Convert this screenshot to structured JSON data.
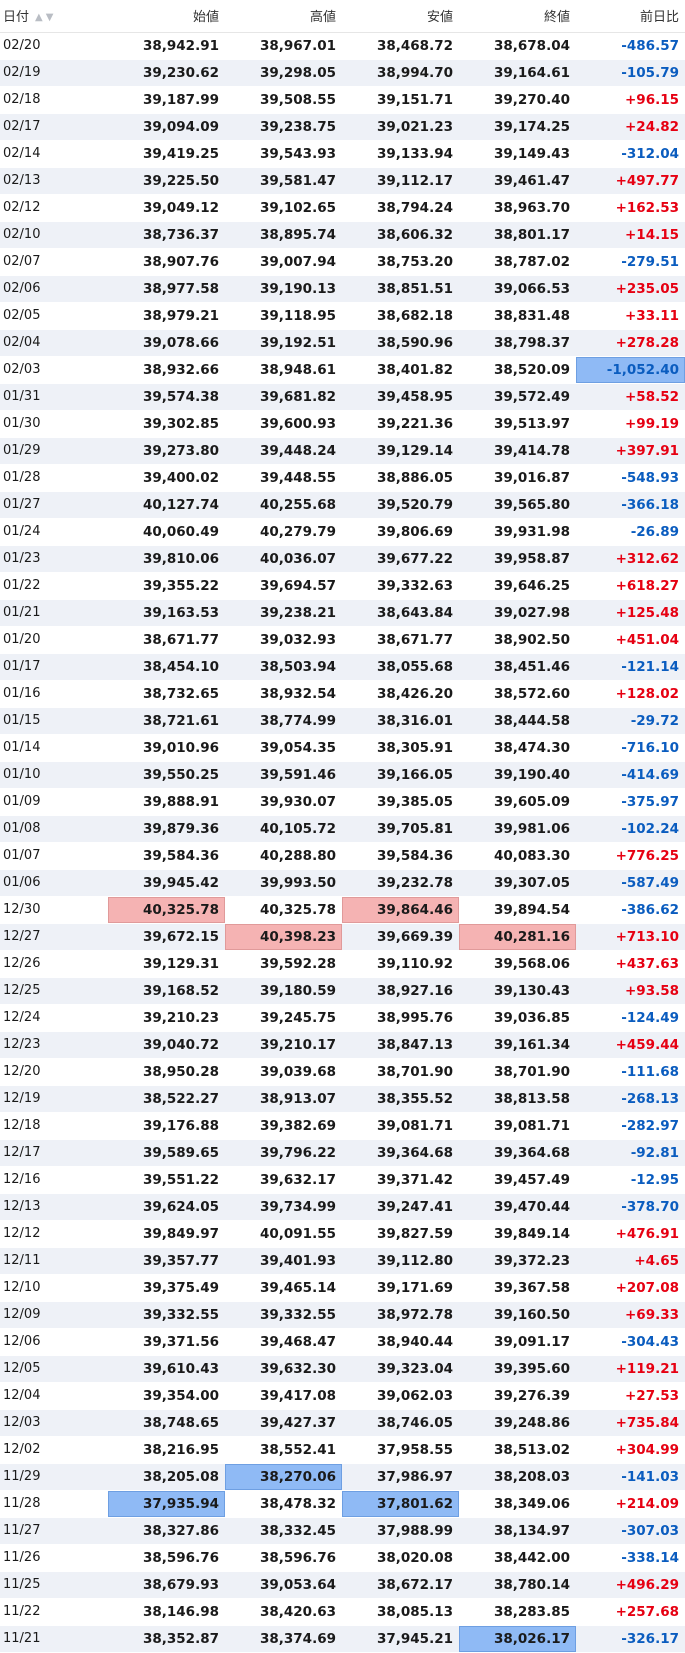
{
  "headers": {
    "date": "日付",
    "open": "始値",
    "high": "高値",
    "low": "安値",
    "close": "終値",
    "change": "前日比"
  },
  "rows": [
    {
      "date": "02/20",
      "open": "38,942.91",
      "high": "38,967.01",
      "low": "38,468.72",
      "close": "38,678.04",
      "change": "-486.57"
    },
    {
      "date": "02/19",
      "open": "39,230.62",
      "high": "39,298.05",
      "low": "38,994.70",
      "close": "39,164.61",
      "change": "-105.79"
    },
    {
      "date": "02/18",
      "open": "39,187.99",
      "high": "39,508.55",
      "low": "39,151.71",
      "close": "39,270.40",
      "change": "+96.15"
    },
    {
      "date": "02/17",
      "open": "39,094.09",
      "high": "39,238.75",
      "low": "39,021.23",
      "close": "39,174.25",
      "change": "+24.82"
    },
    {
      "date": "02/14",
      "open": "39,419.25",
      "high": "39,543.93",
      "low": "39,133.94",
      "close": "39,149.43",
      "change": "-312.04"
    },
    {
      "date": "02/13",
      "open": "39,225.50",
      "high": "39,581.47",
      "low": "39,112.17",
      "close": "39,461.47",
      "change": "+497.77"
    },
    {
      "date": "02/12",
      "open": "39,049.12",
      "high": "39,102.65",
      "low": "38,794.24",
      "close": "38,963.70",
      "change": "+162.53"
    },
    {
      "date": "02/10",
      "open": "38,736.37",
      "high": "38,895.74",
      "low": "38,606.32",
      "close": "38,801.17",
      "change": "+14.15"
    },
    {
      "date": "02/07",
      "open": "38,907.76",
      "high": "39,007.94",
      "low": "38,753.20",
      "close": "38,787.02",
      "change": "-279.51"
    },
    {
      "date": "02/06",
      "open": "38,977.58",
      "high": "39,190.13",
      "low": "38,851.51",
      "close": "39,066.53",
      "change": "+235.05"
    },
    {
      "date": "02/05",
      "open": "38,979.21",
      "high": "39,118.95",
      "low": "38,682.18",
      "close": "38,831.48",
      "change": "+33.11"
    },
    {
      "date": "02/04",
      "open": "39,078.66",
      "high": "39,192.51",
      "low": "38,590.96",
      "close": "38,798.37",
      "change": "+278.28"
    },
    {
      "date": "02/03",
      "open": "38,932.66",
      "high": "38,948.61",
      "low": "38,401.82",
      "close": "38,520.09",
      "change": "-1,052.40",
      "hl": {
        "change": "blue"
      }
    },
    {
      "date": "01/31",
      "open": "39,574.38",
      "high": "39,681.82",
      "low": "39,458.95",
      "close": "39,572.49",
      "change": "+58.52"
    },
    {
      "date": "01/30",
      "open": "39,302.85",
      "high": "39,600.93",
      "low": "39,221.36",
      "close": "39,513.97",
      "change": "+99.19"
    },
    {
      "date": "01/29",
      "open": "39,273.80",
      "high": "39,448.24",
      "low": "39,129.14",
      "close": "39,414.78",
      "change": "+397.91"
    },
    {
      "date": "01/28",
      "open": "39,400.02",
      "high": "39,448.55",
      "low": "38,886.05",
      "close": "39,016.87",
      "change": "-548.93"
    },
    {
      "date": "01/27",
      "open": "40,127.74",
      "high": "40,255.68",
      "low": "39,520.79",
      "close": "39,565.80",
      "change": "-366.18"
    },
    {
      "date": "01/24",
      "open": "40,060.49",
      "high": "40,279.79",
      "low": "39,806.69",
      "close": "39,931.98",
      "change": "-26.89"
    },
    {
      "date": "01/23",
      "open": "39,810.06",
      "high": "40,036.07",
      "low": "39,677.22",
      "close": "39,958.87",
      "change": "+312.62"
    },
    {
      "date": "01/22",
      "open": "39,355.22",
      "high": "39,694.57",
      "low": "39,332.63",
      "close": "39,646.25",
      "change": "+618.27"
    },
    {
      "date": "01/21",
      "open": "39,163.53",
      "high": "39,238.21",
      "low": "38,643.84",
      "close": "39,027.98",
      "change": "+125.48"
    },
    {
      "date": "01/20",
      "open": "38,671.77",
      "high": "39,032.93",
      "low": "38,671.77",
      "close": "38,902.50",
      "change": "+451.04"
    },
    {
      "date": "01/17",
      "open": "38,454.10",
      "high": "38,503.94",
      "low": "38,055.68",
      "close": "38,451.46",
      "change": "-121.14"
    },
    {
      "date": "01/16",
      "open": "38,732.65",
      "high": "38,932.54",
      "low": "38,426.20",
      "close": "38,572.60",
      "change": "+128.02"
    },
    {
      "date": "01/15",
      "open": "38,721.61",
      "high": "38,774.99",
      "low": "38,316.01",
      "close": "38,444.58",
      "change": "-29.72"
    },
    {
      "date": "01/14",
      "open": "39,010.96",
      "high": "39,054.35",
      "low": "38,305.91",
      "close": "38,474.30",
      "change": "-716.10"
    },
    {
      "date": "01/10",
      "open": "39,550.25",
      "high": "39,591.46",
      "low": "39,166.05",
      "close": "39,190.40",
      "change": "-414.69"
    },
    {
      "date": "01/09",
      "open": "39,888.91",
      "high": "39,930.07",
      "low": "39,385.05",
      "close": "39,605.09",
      "change": "-375.97"
    },
    {
      "date": "01/08",
      "open": "39,879.36",
      "high": "40,105.72",
      "low": "39,705.81",
      "close": "39,981.06",
      "change": "-102.24"
    },
    {
      "date": "01/07",
      "open": "39,584.36",
      "high": "40,288.80",
      "low": "39,584.36",
      "close": "40,083.30",
      "change": "+776.25"
    },
    {
      "date": "01/06",
      "open": "39,945.42",
      "high": "39,993.50",
      "low": "39,232.78",
      "close": "39,307.05",
      "change": "-587.49"
    },
    {
      "date": "12/30",
      "open": "40,325.78",
      "high": "40,325.78",
      "low": "39,864.46",
      "close": "39,894.54",
      "change": "-386.62",
      "hl": {
        "open": "red",
        "low": "red"
      }
    },
    {
      "date": "12/27",
      "open": "39,672.15",
      "high": "40,398.23",
      "low": "39,669.39",
      "close": "40,281.16",
      "change": "+713.10",
      "hl": {
        "high": "red",
        "close": "red"
      }
    },
    {
      "date": "12/26",
      "open": "39,129.31",
      "high": "39,592.28",
      "low": "39,110.92",
      "close": "39,568.06",
      "change": "+437.63"
    },
    {
      "date": "12/25",
      "open": "39,168.52",
      "high": "39,180.59",
      "low": "38,927.16",
      "close": "39,130.43",
      "change": "+93.58"
    },
    {
      "date": "12/24",
      "open": "39,210.23",
      "high": "39,245.75",
      "low": "38,995.76",
      "close": "39,036.85",
      "change": "-124.49"
    },
    {
      "date": "12/23",
      "open": "39,040.72",
      "high": "39,210.17",
      "low": "38,847.13",
      "close": "39,161.34",
      "change": "+459.44"
    },
    {
      "date": "12/20",
      "open": "38,950.28",
      "high": "39,039.68",
      "low": "38,701.90",
      "close": "38,701.90",
      "change": "-111.68"
    },
    {
      "date": "12/19",
      "open": "38,522.27",
      "high": "38,913.07",
      "low": "38,355.52",
      "close": "38,813.58",
      "change": "-268.13"
    },
    {
      "date": "12/18",
      "open": "39,176.88",
      "high": "39,382.69",
      "low": "39,081.71",
      "close": "39,081.71",
      "change": "-282.97"
    },
    {
      "date": "12/17",
      "open": "39,589.65",
      "high": "39,796.22",
      "low": "39,364.68",
      "close": "39,364.68",
      "change": "-92.81"
    },
    {
      "date": "12/16",
      "open": "39,551.22",
      "high": "39,632.17",
      "low": "39,371.42",
      "close": "39,457.49",
      "change": "-12.95"
    },
    {
      "date": "12/13",
      "open": "39,624.05",
      "high": "39,734.99",
      "low": "39,247.41",
      "close": "39,470.44",
      "change": "-378.70"
    },
    {
      "date": "12/12",
      "open": "39,849.97",
      "high": "40,091.55",
      "low": "39,827.59",
      "close": "39,849.14",
      "change": "+476.91"
    },
    {
      "date": "12/11",
      "open": "39,357.77",
      "high": "39,401.93",
      "low": "39,112.80",
      "close": "39,372.23",
      "change": "+4.65"
    },
    {
      "date": "12/10",
      "open": "39,375.49",
      "high": "39,465.14",
      "low": "39,171.69",
      "close": "39,367.58",
      "change": "+207.08"
    },
    {
      "date": "12/09",
      "open": "39,332.55",
      "high": "39,332.55",
      "low": "38,972.78",
      "close": "39,160.50",
      "change": "+69.33"
    },
    {
      "date": "12/06",
      "open": "39,371.56",
      "high": "39,468.47",
      "low": "38,940.44",
      "close": "39,091.17",
      "change": "-304.43"
    },
    {
      "date": "12/05",
      "open": "39,610.43",
      "high": "39,632.30",
      "low": "39,323.04",
      "close": "39,395.60",
      "change": "+119.21"
    },
    {
      "date": "12/04",
      "open": "39,354.00",
      "high": "39,417.08",
      "low": "39,062.03",
      "close": "39,276.39",
      "change": "+27.53"
    },
    {
      "date": "12/03",
      "open": "38,748.65",
      "high": "39,427.37",
      "low": "38,746.05",
      "close": "39,248.86",
      "change": "+735.84"
    },
    {
      "date": "12/02",
      "open": "38,216.95",
      "high": "38,552.41",
      "low": "37,958.55",
      "close": "38,513.02",
      "change": "+304.99"
    },
    {
      "date": "11/29",
      "open": "38,205.08",
      "high": "38,270.06",
      "low": "37,986.97",
      "close": "38,208.03",
      "change": "-141.03",
      "hl": {
        "high": "blue"
      }
    },
    {
      "date": "11/28",
      "open": "37,935.94",
      "high": "38,478.32",
      "low": "37,801.62",
      "close": "38,349.06",
      "change": "+214.09",
      "hl": {
        "open": "blue",
        "low": "blue"
      }
    },
    {
      "date": "11/27",
      "open": "38,327.86",
      "high": "38,332.45",
      "low": "37,988.99",
      "close": "38,134.97",
      "change": "-307.03"
    },
    {
      "date": "11/26",
      "open": "38,596.76",
      "high": "38,596.76",
      "low": "38,020.08",
      "close": "38,442.00",
      "change": "-338.14"
    },
    {
      "date": "11/25",
      "open": "38,679.93",
      "high": "39,053.64",
      "low": "38,672.17",
      "close": "38,780.14",
      "change": "+496.29"
    },
    {
      "date": "11/22",
      "open": "38,146.98",
      "high": "38,420.63",
      "low": "38,085.13",
      "close": "38,283.85",
      "change": "+257.68"
    },
    {
      "date": "11/21",
      "open": "38,352.87",
      "high": "38,374.69",
      "low": "37,945.21",
      "close": "38,026.17",
      "change": "-326.17",
      "hl": {
        "close": "blue"
      }
    }
  ]
}
